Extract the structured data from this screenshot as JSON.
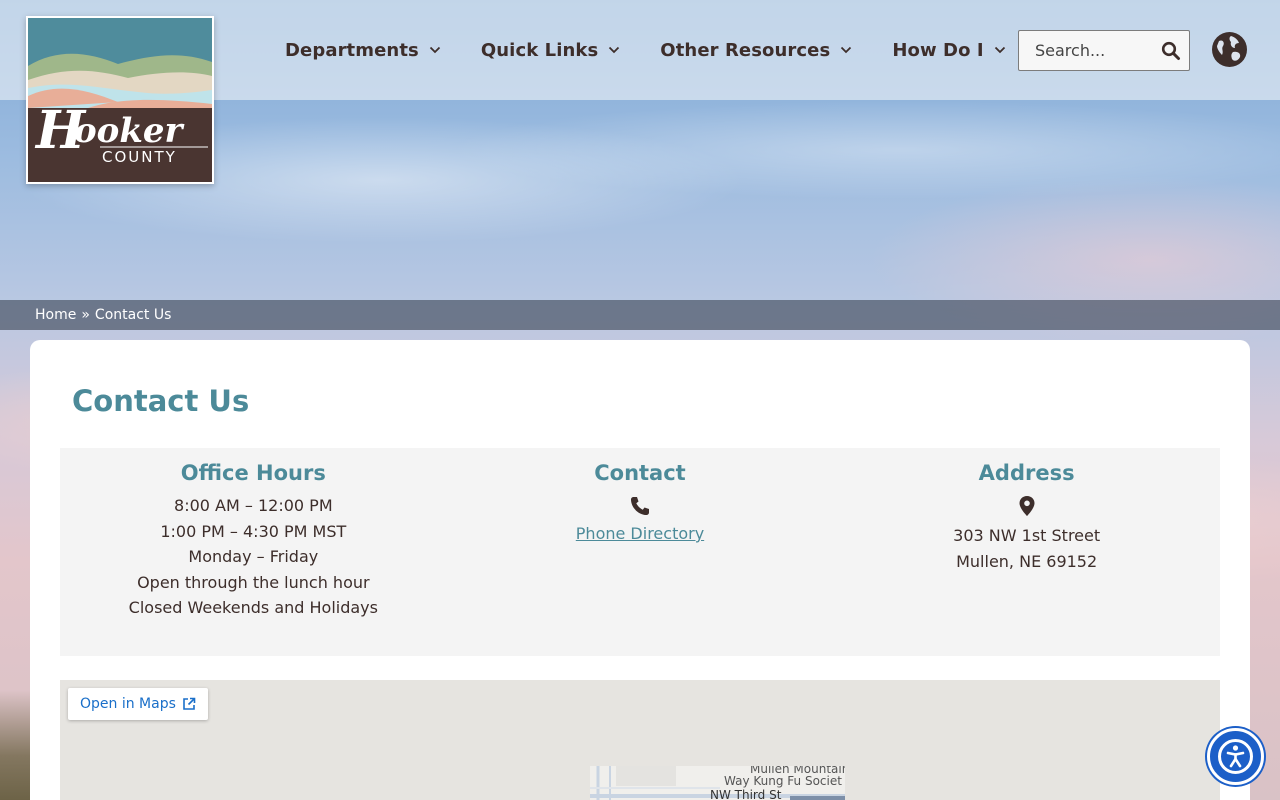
{
  "header": {
    "logo_alt": "Hooker County",
    "nav": [
      {
        "label": "Departments"
      },
      {
        "label": "Quick Links"
      },
      {
        "label": "Other Resources"
      },
      {
        "label": "How Do I"
      }
    ],
    "search": {
      "placeholder": "Search..."
    },
    "icons": {
      "search": "search-icon",
      "globe": "globe-icon",
      "chevron": "chevron-down-icon"
    }
  },
  "breadcrumb": {
    "home": "Home",
    "separator": "»",
    "current": "Contact Us"
  },
  "main": {
    "title": "Contact Us",
    "office_hours": {
      "heading": "Office Hours",
      "lines": [
        "8:00 AM – 12:00 PM",
        "1:00 PM – 4:30 PM MST",
        "Monday – Friday",
        "Open through the lunch hour",
        "Closed Weekends and Holidays"
      ]
    },
    "contact": {
      "heading": "Contact",
      "icon": "phone-icon",
      "link": "Phone Directory"
    },
    "address": {
      "heading": "Address",
      "icon": "map-pin-icon",
      "lines": [
        "303 NW 1st Street",
        "Mullen, NE 69152"
      ]
    }
  },
  "map": {
    "open_label": "Open in Maps",
    "labels": [
      "Mullen Mountain",
      "Way Kung Fu Societ",
      "NW Third St"
    ]
  },
  "colors": {
    "accent": "#4c8a99",
    "text": "#3d2e2b",
    "link_blue": "#1a6fc9",
    "a11y_blue": "#1c5fc8"
  },
  "accessibility": {
    "icon": "accessibility-icon"
  }
}
